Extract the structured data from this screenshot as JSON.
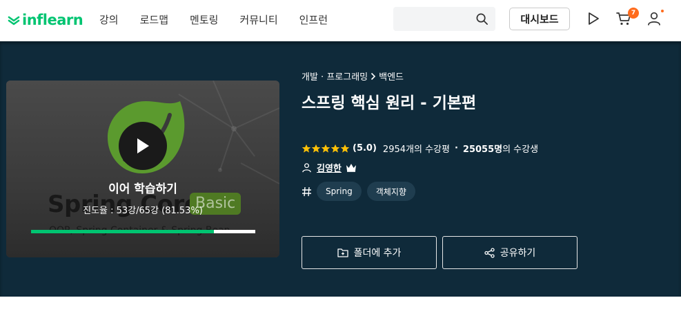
{
  "nav": {
    "logo": "inflearn",
    "menu": [
      "강의",
      "로드맵",
      "멘토링",
      "커뮤니티",
      "인프런"
    ],
    "search_placeholder": "",
    "dashboard_label": "대시보드",
    "cart_count": "7"
  },
  "course": {
    "breadcrumb": [
      "개발 · 프로그래밍",
      "백엔드"
    ],
    "title": "스프링 핵심 원리 - 기본편",
    "rating": "(5.0)",
    "stars": 5,
    "reviews": "2954개의 수강평",
    "bullet": "·",
    "students_count": "25055명",
    "students_suffix": "의 수강생",
    "author": "김영한",
    "tags": [
      "Spring",
      "객체지향"
    ]
  },
  "thumbnail": {
    "resume_label": "이어 학습하기",
    "progress_text": "진도율 : 53강/65강 (81.53%)",
    "progress_fraction": 0.8153,
    "title_text": "Spring Core",
    "badge_text": "Basic",
    "subtitle_text": "OOP, Spring Container & Spring Bean"
  },
  "actions": {
    "folder_label": "폴더에 추가",
    "share_label": "공유하기"
  },
  "colors": {
    "brand": "#00c471",
    "hero_bg": "#0f2a3a",
    "star": "#ffc107",
    "badge": "#ff6b1c"
  }
}
